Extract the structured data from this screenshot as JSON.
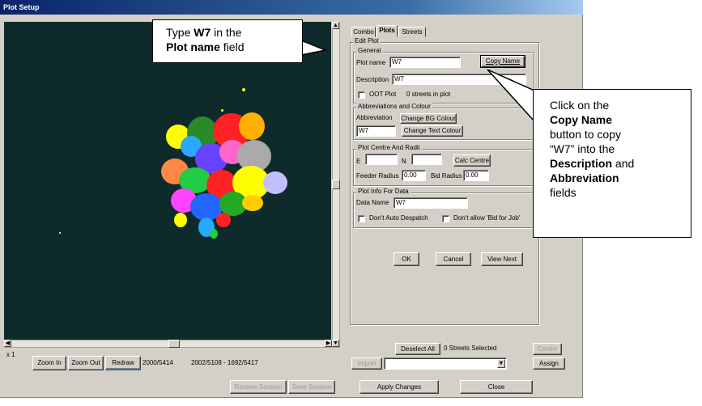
{
  "window": {
    "title": "Plot Setup"
  },
  "tabs": [
    {
      "label": "Combo"
    },
    {
      "label": "Plots"
    },
    {
      "label": "Streets"
    }
  ],
  "edit_plot": {
    "group_label": "Edit Plot",
    "general": {
      "label": "General",
      "plot_name_label": "Plot name",
      "plot_name_value": "W7",
      "copy_name_button": "Copy Name",
      "description_label": "Description",
      "description_value": "W7",
      "oot_plot_label": "OOT Plot",
      "streets_count": "0 streets in plot"
    },
    "abbrev": {
      "label": "Abbreviations and Colour",
      "abbreviation_label": "Abbreviation",
      "change_bg_button": "Change BG Colour",
      "abbreviation_value": "W7",
      "change_text_button": "Change Text Colour"
    },
    "centre": {
      "label": "Plot Centre And Radii",
      "e_label": "E",
      "n_label": "N",
      "calc_centre_button": "Calc Centre",
      "feeder_radius_label": "Feeder Radius",
      "feeder_radius_value": "0.00",
      "bid_radius_label": "Bid Radius",
      "bid_radius_value": "0.00"
    },
    "info": {
      "label": "Plot Info For Data",
      "data_name_label": "Data Name",
      "data_name_value": "W7",
      "dont_auto_despatch": "Don't Auto Despatch",
      "dont_allow_bid": "Don't allow 'Bid for Job'"
    }
  },
  "dialog_buttons": {
    "ok": "OK",
    "cancel": "Cancel",
    "view_next": "View Next"
  },
  "street_bar": {
    "deselect_all": "Deselect All",
    "selected_count": "0 Streets Selected",
    "centre": "Centre",
    "import": "Import",
    "assign": "Assign"
  },
  "map_bar": {
    "zoom_level": "x 1",
    "zoom_in": "Zoom In",
    "zoom_out": "Zoom Out",
    "redraw": "Redraw",
    "coords_a": "2000/5414",
    "coords_b": "2002/5108 - 1692/5417"
  },
  "bottom_bar": {
    "restore_session": "Restore Session",
    "save_session": "Save Session",
    "apply_changes": "Apply Changes",
    "close": "Close"
  },
  "callouts": {
    "left": {
      "pre": "Type ",
      "bold1": "W7",
      "mid": " in the",
      "bold2": "Plot name",
      "post": " field"
    },
    "right": {
      "line1": "Click on the",
      "bold1": "Copy Name",
      "line3": "button to copy",
      "line4": "“W7” into the",
      "bold2": "Description",
      "line5_post": " and",
      "bold3": "Abbreviation",
      "line7": "fields"
    }
  },
  "colors": {
    "title_bar": "#0a246a",
    "map_background": "#0f2a2a",
    "dialog_face": "#d4d0c8"
  },
  "icons": [
    "scroll-up-arrow-icon",
    "scroll-down-arrow-icon",
    "scroll-left-arrow-icon",
    "scroll-right-arrow-icon",
    "dropdown-arrow-icon"
  ]
}
